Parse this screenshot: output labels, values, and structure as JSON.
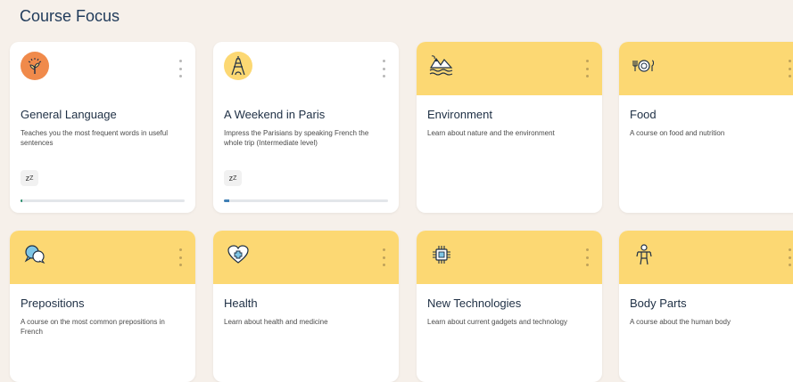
{
  "page": {
    "title": "Course Focus"
  },
  "colors": {
    "accent_yellow": "#fcd873",
    "title_blue": "#1f3a5a",
    "progress_green": "#2a8f6c",
    "progress_blue": "#3f7fb5"
  },
  "cards": [
    {
      "title": "General Language",
      "description": "Teaches you the most frequent words in useful sentences",
      "icon": "sun-plant-icon",
      "snooze": "zZ",
      "progress": 0.01
    },
    {
      "title": "A Weekend in Paris",
      "description": "Impress the Parisians by speaking French the whole trip (Intermediate level)",
      "icon": "eiffel-tower-icon",
      "snooze": "zZ",
      "progress": 0.03
    },
    {
      "title": "Environment",
      "description": "Learn about nature and the environment",
      "icon": "mountains-water-icon"
    },
    {
      "title": "Food",
      "description": "A course on food and nutrition",
      "icon": "food-icon"
    },
    {
      "title": "Prepositions",
      "description": "A course on the most common prepositions in French",
      "icon": "speech-bubbles-icon"
    },
    {
      "title": "Health",
      "description": "Learn about health and medicine",
      "icon": "heart-medical-icon"
    },
    {
      "title": "New Technologies",
      "description": "Learn about current gadgets and technology",
      "icon": "chip-icon"
    },
    {
      "title": "Body Parts",
      "description": "A course about the human body",
      "icon": "person-icon"
    }
  ]
}
